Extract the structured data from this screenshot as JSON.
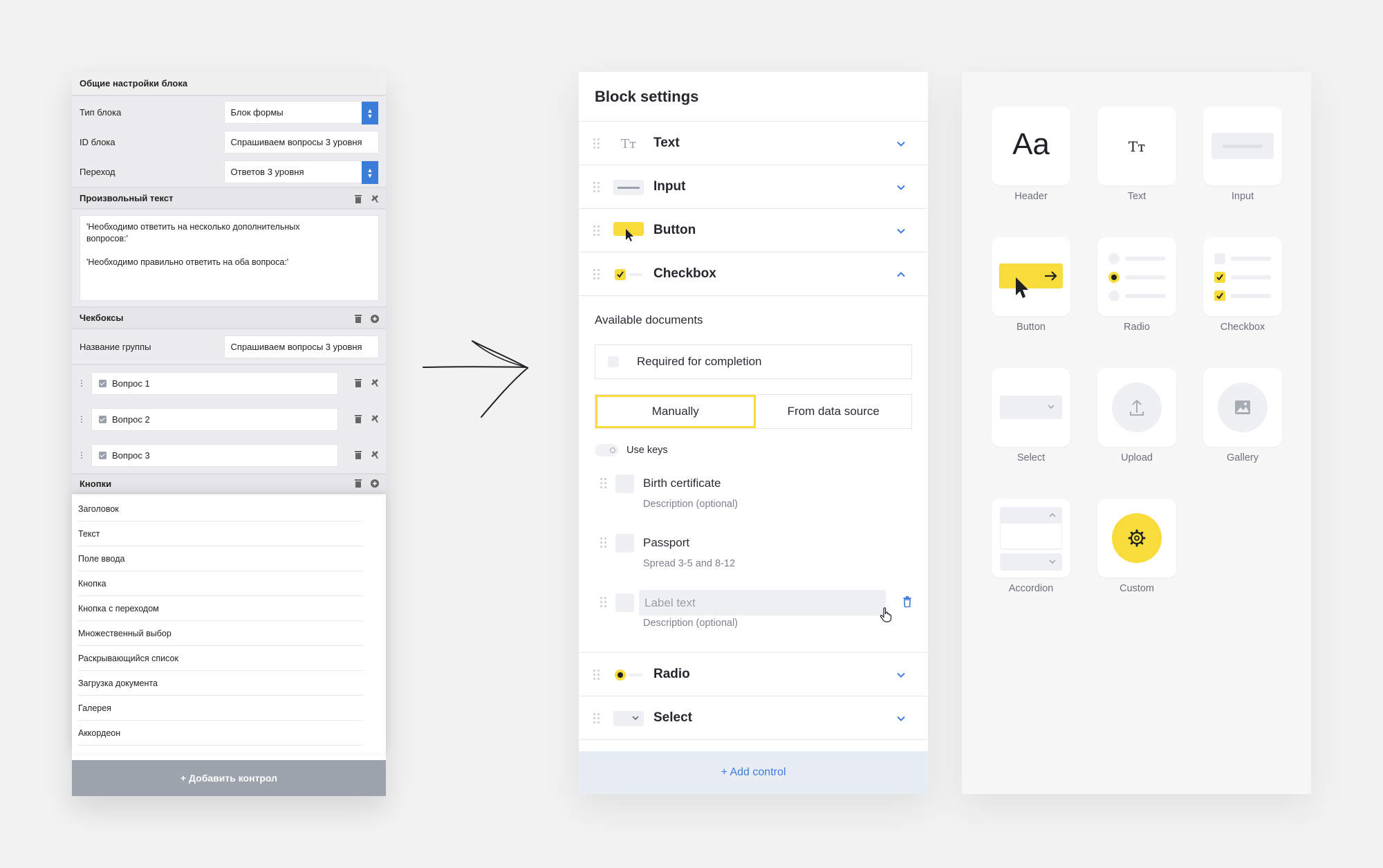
{
  "old_panel": {
    "header": "Общие настройки блока",
    "rows": [
      {
        "label": "Тип блока",
        "value": "Блок формы",
        "has_arrows": true
      },
      {
        "label": "ID блока",
        "value": "Спрашиваем вопросы 3 уровня",
        "has_arrows": false
      },
      {
        "label": "Переход",
        "value": "Ответов 3 уровня",
        "has_arrows": true
      }
    ],
    "custom_text_header": "Произвольный текст",
    "custom_text_line1": "'Необходимо ответить на несколько дополнительных вопросов:'",
    "custom_text_line2": "'Необходимо правильно ответить на оба вопроса:'",
    "checkboxes_header": "Чекбоксы",
    "group_label": "Название группы",
    "group_value": "Спрашиваем вопросы 3 уровня",
    "questions": [
      "Вопрос 1",
      "Вопрос 2",
      "Вопрос 3"
    ],
    "buttons_header": "Кнопки",
    "dropdown_items": [
      "Заголовок",
      "Текст",
      "Поле ввода",
      "Кнопка",
      "Кнопка с переходом",
      "Множественный выбор",
      "Раскрывающийся список",
      "Загрузка документа",
      "Галерея",
      "Аккордеон"
    ],
    "footer": "+ Добавить контрол"
  },
  "block_settings": {
    "title": "Block settings",
    "controls_top": [
      {
        "name": "Text",
        "icon": "text-type-icon",
        "expanded": false
      },
      {
        "name": "Input",
        "icon": "input-icon",
        "expanded": false
      },
      {
        "name": "Button",
        "icon": "button-icon",
        "expanded": false
      },
      {
        "name": "Checkbox",
        "icon": "checkbox-icon",
        "expanded": true
      }
    ],
    "available_documents": "Available documents",
    "required_label": "Required for completion",
    "segment": {
      "manual": "Manually",
      "data_source": "From data source",
      "selected": "manual"
    },
    "use_keys": "Use keys",
    "documents": [
      {
        "title": "Birth certificate",
        "description": "Description (optional)"
      },
      {
        "title": "Passport",
        "description": "Spread 3-5 and 8-12"
      }
    ],
    "new_document": {
      "placeholder": "Label text",
      "description": "Description (optional)"
    },
    "controls_bottom": [
      {
        "name": "Radio",
        "icon": "radio-icon",
        "expanded": false
      },
      {
        "name": "Select",
        "icon": "select-icon",
        "expanded": false
      }
    ],
    "add_control": "+ Add control",
    "accent_color": "#f7dc3b",
    "link_color": "#3f7be0"
  },
  "gallery": {
    "tiles": [
      {
        "label": "Header",
        "icon": "header-icon",
        "glyph": "Aa"
      },
      {
        "label": "Text",
        "icon": "text-icon",
        "glyph": "Tт"
      },
      {
        "label": "Input",
        "icon": "input-icon"
      },
      {
        "label": "Button",
        "icon": "button-icon"
      },
      {
        "label": "Radio",
        "icon": "radio-icon"
      },
      {
        "label": "Checkbox",
        "icon": "checkbox-icon"
      },
      {
        "label": "Select",
        "icon": "select-icon"
      },
      {
        "label": "Upload",
        "icon": "upload-icon"
      },
      {
        "label": "Gallery",
        "icon": "gallery-icon"
      },
      {
        "label": "Accordion",
        "icon": "accordion-icon"
      },
      {
        "label": "Custom",
        "icon": "gear-icon"
      }
    ]
  }
}
